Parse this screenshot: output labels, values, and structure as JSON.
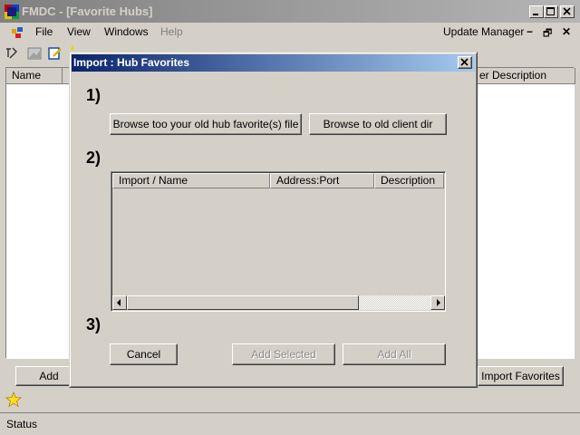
{
  "app": {
    "title": "FMDC - [Favorite Hubs]",
    "caption_buttons": [
      "minimize",
      "maximize",
      "close"
    ]
  },
  "menu": {
    "items": [
      "File",
      "View",
      "Windows",
      "Help"
    ],
    "update_manager": "Update Manager",
    "mdi_controls": [
      "−",
      "🗗",
      "✕"
    ]
  },
  "background_list": {
    "columns": [
      "Name",
      "er Description"
    ]
  },
  "background_buttons": {
    "add": "Add",
    "import_favorites": "Import Favorites"
  },
  "status": {
    "text": "Status"
  },
  "dialog": {
    "title": "Import : Hub Favorites",
    "close": "✕",
    "step1": "1)",
    "step2": "2)",
    "step3": "3)",
    "browse_file": "Browse too your old hub favorite(s) file",
    "browse_dir": "Browse to old client dir",
    "columns": [
      "Import / Name",
      "Address:Port",
      "Description"
    ],
    "cancel": "Cancel",
    "add_selected": "Add Selected",
    "add_all": "Add All"
  },
  "icons": {
    "app_icon": "fmdc-app-icon",
    "toolbar": [
      "connect-icon",
      "image-icon",
      "edit-icon",
      "favorite-star-icon"
    ],
    "status_star": "star-icon"
  }
}
